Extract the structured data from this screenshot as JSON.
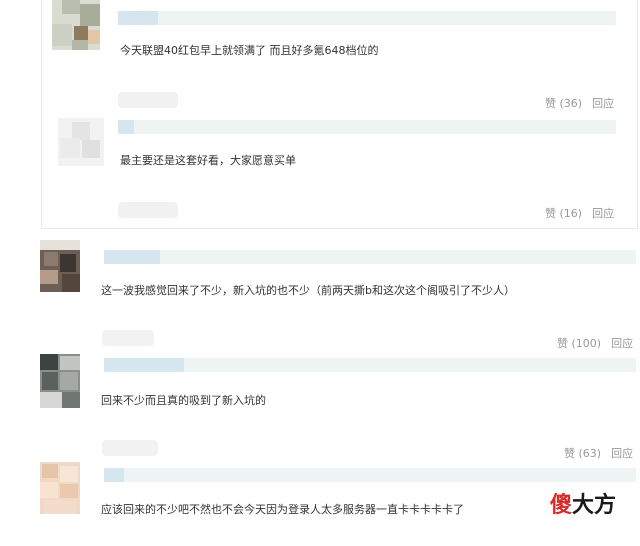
{
  "nested_replies": [
    {
      "text": "今天联盟40红包早上就领满了 而且好多氪648档位的",
      "likes": "赞 (36)",
      "reply": "回应"
    },
    {
      "text": "最主要还是这套好看，大家愿意买单",
      "likes": "赞 (16)",
      "reply": "回应"
    }
  ],
  "comments": [
    {
      "text": "这一波我感觉回来了不少，新入坑的也不少（前两天撕b和这次这个阁吸引了不少人）",
      "likes": "赞 (100)",
      "reply": "回应"
    },
    {
      "text": "回来不少而且真的吸到了新入坑的",
      "likes": "赞 (63)",
      "reply": "回应"
    },
    {
      "text": "应该回来的不少吧不然也不会今天因为登录人太多服务器一直卡卡卡卡卡了"
    }
  ],
  "watermark": {
    "part1": "傻",
    "part2": "大方"
  },
  "colors": {
    "text": "#333333",
    "muted": "#999999",
    "border": "#e8e8e8",
    "name_bar_light": "#eef3f4",
    "name_bar_blue": "#d5e6ef",
    "watermark_red": "#d62b2b"
  }
}
